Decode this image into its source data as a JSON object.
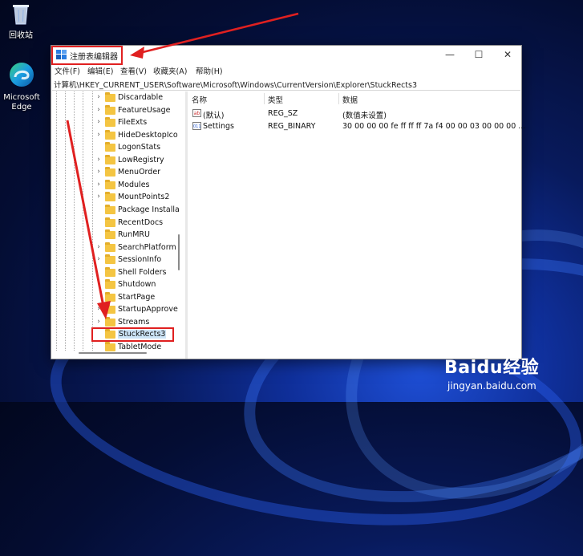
{
  "desktop": {
    "recycle_bin_label": "回收站",
    "edge_label_line1": "Microsoft",
    "edge_label_line2": "Edge"
  },
  "window": {
    "title": "注册表编辑器",
    "controls": {
      "minimize": "—",
      "maximize": "☐",
      "close": "✕"
    }
  },
  "menubar": [
    {
      "label": "文件(F)"
    },
    {
      "label": "编辑(E)"
    },
    {
      "label": "查看(V)"
    },
    {
      "label": "收藏夹(A)"
    },
    {
      "label": "帮助(H)"
    }
  ],
  "address": "计算机\\HKEY_CURRENT_USER\\Software\\Microsoft\\Windows\\CurrentVersion\\Explorer\\StuckRects3",
  "tree": {
    "items": [
      {
        "label": "Discardable",
        "expandable": true
      },
      {
        "label": "FeatureUsage",
        "expandable": true
      },
      {
        "label": "FileExts",
        "expandable": true
      },
      {
        "label": "HideDesktopIco",
        "expandable": true
      },
      {
        "label": "LogonStats",
        "expandable": false
      },
      {
        "label": "LowRegistry",
        "expandable": true
      },
      {
        "label": "MenuOrder",
        "expandable": true
      },
      {
        "label": "Modules",
        "expandable": true
      },
      {
        "label": "MountPoints2",
        "expandable": true
      },
      {
        "label": "Package Installa",
        "expandable": false
      },
      {
        "label": "RecentDocs",
        "expandable": false
      },
      {
        "label": "RunMRU",
        "expandable": false
      },
      {
        "label": "SearchPlatform",
        "expandable": true
      },
      {
        "label": "SessionInfo",
        "expandable": true
      },
      {
        "label": "Shell Folders",
        "expandable": false
      },
      {
        "label": "Shutdown",
        "expandable": false
      },
      {
        "label": "StartPage",
        "expandable": false
      },
      {
        "label": "StartupApprove",
        "expandable": true
      },
      {
        "label": "Streams",
        "expandable": true
      },
      {
        "label": "StuckRects3",
        "expandable": false,
        "selected": true
      },
      {
        "label": "TabletMode",
        "expandable": false
      }
    ]
  },
  "list": {
    "columns": [
      "名称",
      "类型",
      "数据"
    ],
    "rows": [
      {
        "name": "(默认)",
        "type": "REG_SZ",
        "data": "(数值未设置)",
        "icon": "string-value-icon"
      },
      {
        "name": "Settings",
        "type": "REG_BINARY",
        "data": "30 00 00 00 fe ff ff ff 7a f4 00 00 03 00 00 00 ...",
        "icon": "binary-value-icon"
      }
    ]
  },
  "watermark": {
    "logo": "Baidu经验",
    "url": "jingyan.baidu.com"
  },
  "colors": {
    "annotation_red": "#e02020",
    "folder_yellow": "#f4c542",
    "selection_blue": "#cce4f7"
  }
}
